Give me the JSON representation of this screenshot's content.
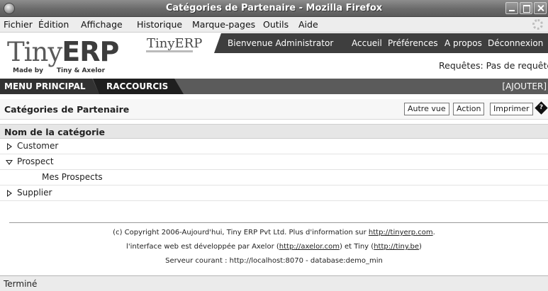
{
  "window": {
    "title": "Catégories de Partenaire - Mozilla Firefox"
  },
  "menubar": {
    "items": [
      "Fichier",
      "Édition",
      "Affichage",
      "Historique",
      "Marque-pages",
      "Outils",
      "Aide"
    ]
  },
  "header": {
    "logo_main": "Tiny",
    "logo_erp": "ERP",
    "logo_sub_left": "Made by",
    "logo_sub_right": "Tiny & Axelor",
    "logo_small": "TinyERP",
    "welcome": "Bienvenue Administrator",
    "links": [
      "Accueil",
      "Préférences",
      "A propos",
      "Déconnexion"
    ],
    "requetes": "Requêtes: Pas de requête"
  },
  "navbar": {
    "tab_menu": "MENU PRINCIPAL",
    "tab_raccourcis": "RACCOURCIS",
    "ajouter": "[AJOUTER]"
  },
  "page": {
    "title": "Catégories de Partenaire",
    "buttons": {
      "autre_vue": "Autre vue",
      "action": "Action",
      "imprimer": "Imprimer"
    }
  },
  "tree": {
    "header": "Nom de la catégorie",
    "rows": [
      {
        "label": "Customer",
        "state": "collapsed"
      },
      {
        "label": "Prospect",
        "state": "expanded"
      },
      {
        "label": "Mes Prospects",
        "state": "leaf"
      },
      {
        "label": "Supplier",
        "state": "collapsed"
      }
    ]
  },
  "footer": {
    "line1_text": "(c) Copyright 2006-Aujourd'hui, Tiny ERP Pvt Ltd. Plus d'information sur ",
    "line1_link": "http://tinyerp.com",
    "line2_a": "l'interface web est développée par Axelor (",
    "line2_link1": "http://axelor.com",
    "line2_b": ") et Tiny (",
    "line2_link2": "http://tiny.be",
    "line3": "Serveur courant : http://localhost:8070 - database:demo_min"
  },
  "statusbar": {
    "text": "Terminé"
  },
  "colors": {
    "nav_dark": "#3e3e3e",
    "tab_active": "#1f1f1f",
    "navbar": "#5b5b5b"
  }
}
